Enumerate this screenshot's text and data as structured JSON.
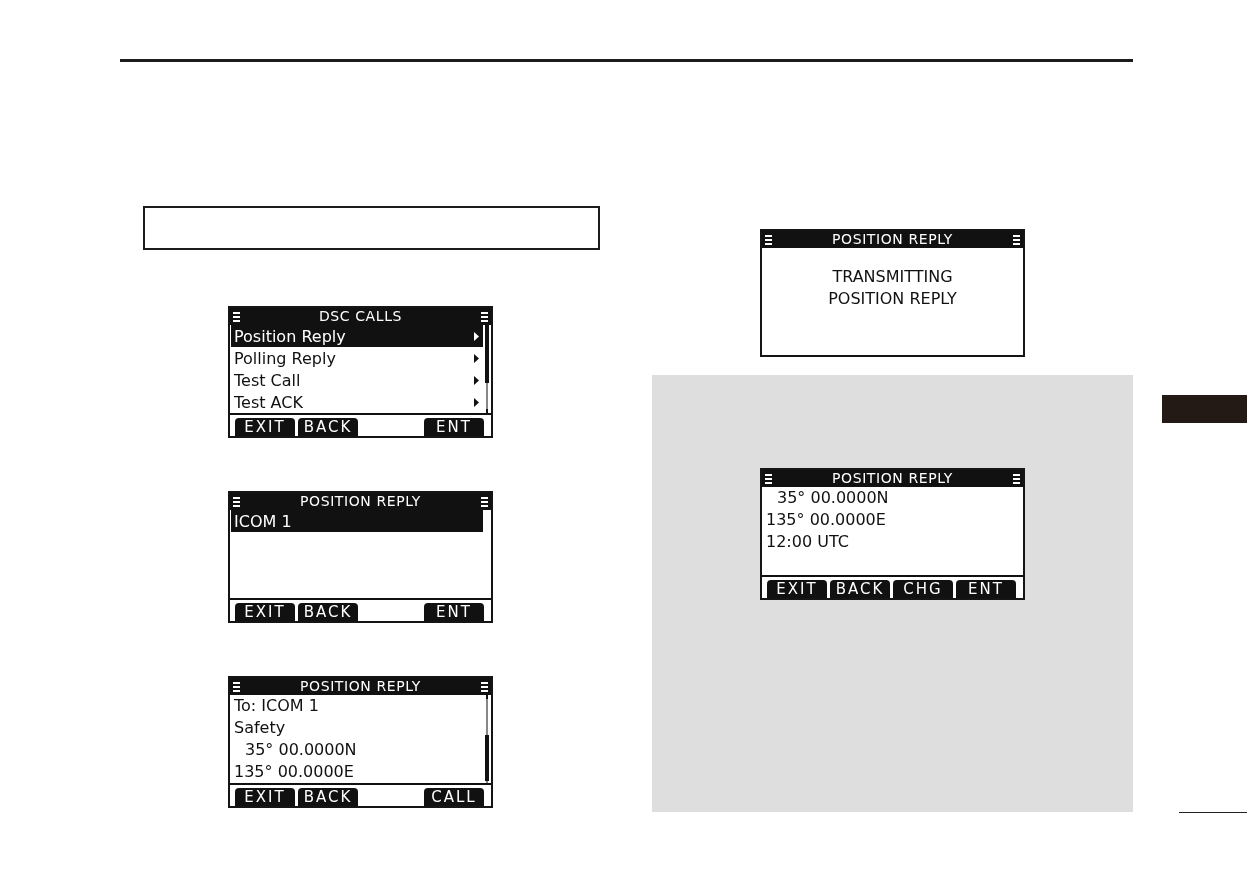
{
  "left_column": {
    "displays": [
      {
        "title": "DSC CALLS",
        "scrollbar": {
          "at_end": false
        },
        "items": [
          {
            "text": "Position Reply",
            "selected": true,
            "kind": "submenu"
          },
          {
            "text": "Polling Reply",
            "selected": false,
            "kind": "submenu"
          },
          {
            "text": "Test Call",
            "selected": false,
            "kind": "submenu"
          },
          {
            "text": "Test ACK",
            "selected": false,
            "kind": "submenu"
          }
        ],
        "softkeys": [
          {
            "kind": "key",
            "label": "EXIT"
          },
          {
            "kind": "key",
            "label": "BACK"
          },
          {
            "kind": "blank"
          },
          {
            "kind": "key",
            "label": "ENT"
          }
        ]
      },
      {
        "title": "POSITION REPLY",
        "items": [
          {
            "text": "ICOM 1",
            "selected": true,
            "kind": "plain"
          }
        ],
        "softkeys": [
          {
            "kind": "key",
            "label": "EXIT"
          },
          {
            "kind": "key",
            "label": "BACK"
          },
          {
            "kind": "blank"
          },
          {
            "kind": "key",
            "label": "ENT"
          }
        ]
      },
      {
        "title": "POSITION REPLY",
        "scrollbar": {
          "at_end": true
        },
        "lines": [
          {
            "text": "To: ICOM 1",
            "kind": "plain"
          },
          {
            "text": "Safety",
            "kind": "plain"
          },
          {
            "text": "35° 00.0000N",
            "kind": "indented"
          },
          {
            "text": "135° 00.0000E",
            "kind": "plain"
          }
        ],
        "softkeys": [
          {
            "kind": "key",
            "label": "EXIT"
          },
          {
            "kind": "key",
            "label": "BACK"
          },
          {
            "kind": "blank"
          },
          {
            "kind": "key",
            "label": "CALL"
          }
        ]
      }
    ]
  },
  "right_column": {
    "displays": [
      {
        "title": "POSITION REPLY",
        "message": [
          "TRANSMITTING",
          "POSITION REPLY"
        ]
      }
    ],
    "shaded_panel": {
      "displays": [
        {
          "title": "POSITION REPLY",
          "lines": [
            {
              "text": "35° 00.0000N",
              "kind": "indented"
            },
            {
              "text": "135° 00.0000E",
              "kind": "plain"
            },
            {
              "text": "12:00 UTC",
              "kind": "plain"
            }
          ],
          "softkeys": [
            {
              "kind": "key",
              "label": "EXIT"
            },
            {
              "kind": "key",
              "label": "BACK"
            },
            {
              "kind": "key",
              "label": "CHG"
            },
            {
              "kind": "key",
              "label": "ENT"
            }
          ]
        }
      ]
    }
  }
}
